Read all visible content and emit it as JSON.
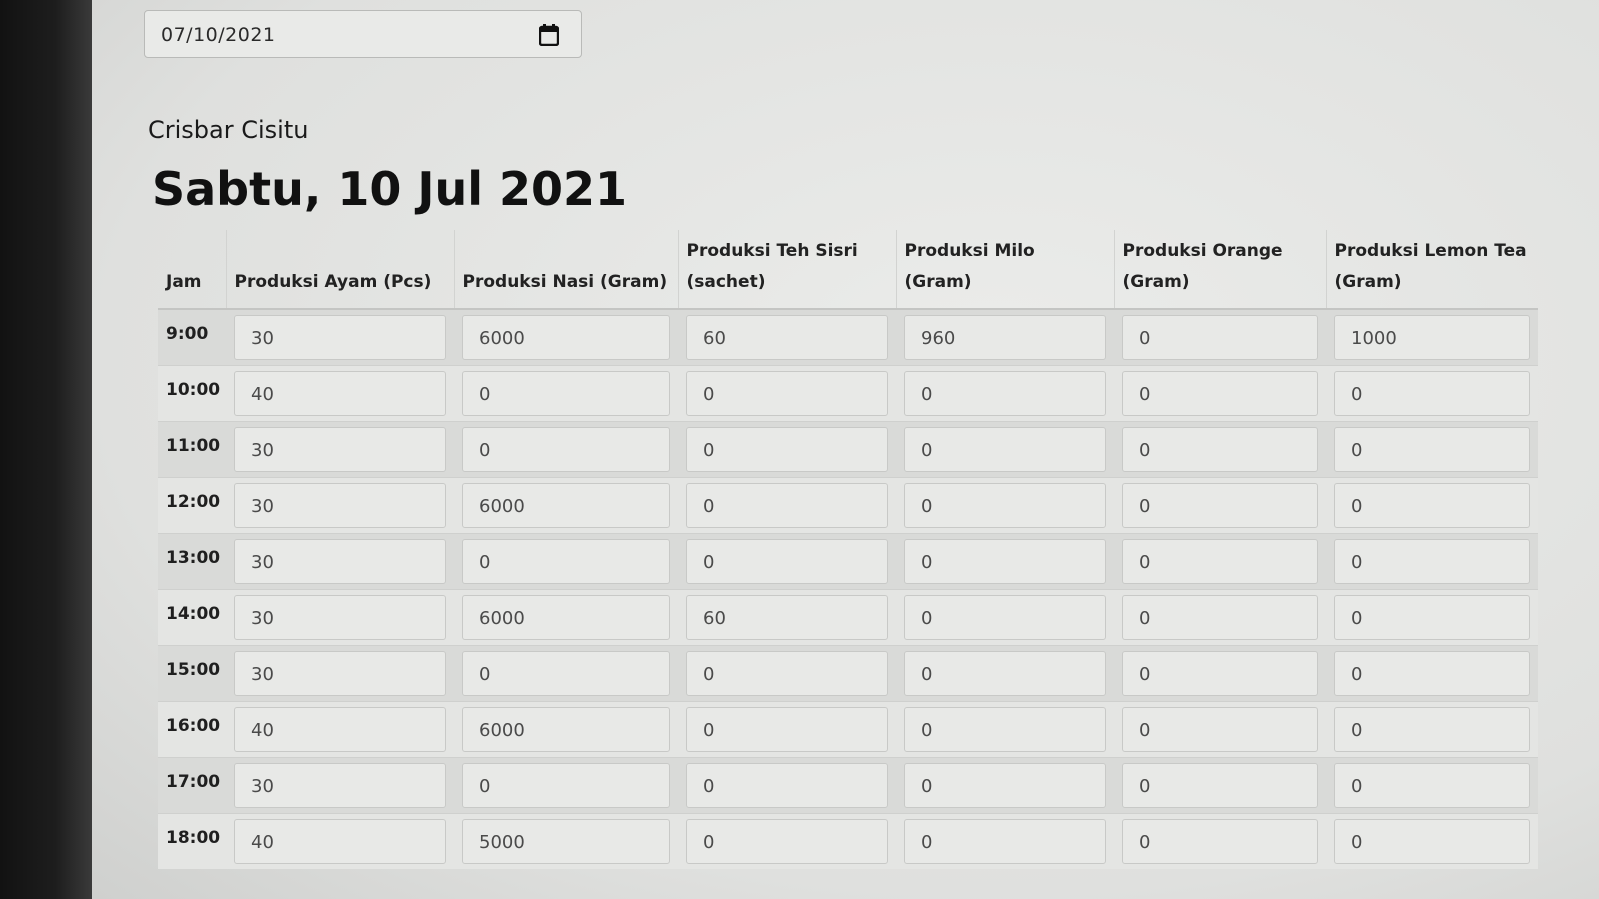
{
  "date_input": {
    "value": "07/10/2021"
  },
  "store_name": "Crisbar Cisitu",
  "day_title": "Sabtu, 10 Jul 2021",
  "table": {
    "headers": [
      "Jam",
      "Produksi Ayam (Pcs)",
      "Produksi Nasi (Gram)",
      "Produksi Teh Sisri (sachet)",
      "Produksi Milo (Gram)",
      "Produksi Orange (Gram)",
      "Produksi Lemon Tea (Gram)"
    ],
    "rows": [
      {
        "jam": "9:00",
        "values": [
          "30",
          "6000",
          "60",
          "960",
          "0",
          "1000"
        ]
      },
      {
        "jam": "10:00",
        "values": [
          "40",
          "0",
          "0",
          "0",
          "0",
          "0"
        ]
      },
      {
        "jam": "11:00",
        "values": [
          "30",
          "0",
          "0",
          "0",
          "0",
          "0"
        ]
      },
      {
        "jam": "12:00",
        "values": [
          "30",
          "6000",
          "0",
          "0",
          "0",
          "0"
        ]
      },
      {
        "jam": "13:00",
        "values": [
          "30",
          "0",
          "0",
          "0",
          "0",
          "0"
        ]
      },
      {
        "jam": "14:00",
        "values": [
          "30",
          "6000",
          "60",
          "0",
          "0",
          "0"
        ]
      },
      {
        "jam": "15:00",
        "values": [
          "30",
          "0",
          "0",
          "0",
          "0",
          "0"
        ]
      },
      {
        "jam": "16:00",
        "values": [
          "40",
          "6000",
          "0",
          "0",
          "0",
          "0"
        ]
      },
      {
        "jam": "17:00",
        "values": [
          "30",
          "0",
          "0",
          "0",
          "0",
          "0"
        ]
      },
      {
        "jam": "18:00",
        "values": [
          "40",
          "5000",
          "0",
          "0",
          "0",
          "0"
        ]
      }
    ]
  }
}
